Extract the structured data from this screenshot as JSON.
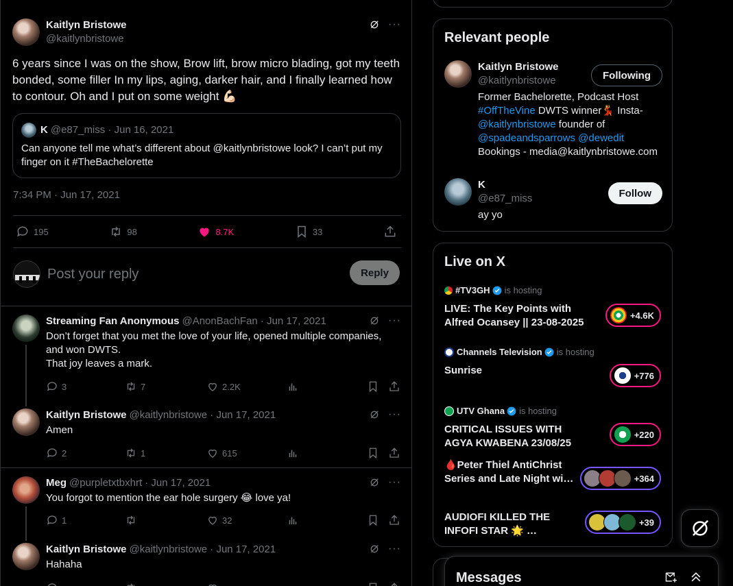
{
  "main_tweet": {
    "author_name": "Kaitlyn Bristowe",
    "author_handle": "@kaitlynbristowe",
    "text": "6 years since I was on the show, Brow lift, brow micro blading, got my teeth bonded, some filler In my lips, aging, darker hair, and I finally learned how to contour. Oh and I put on some weight 💪🏻",
    "quote": {
      "author_name": "K",
      "meta": "@e87_miss · Jun 16, 2021",
      "text": "Can anyone tell me what’s different about @kaitlynbristowe look? I can’t put my finger on it #TheBachelorette"
    },
    "timestamp": "7:34 PM · Jun 17, 2021",
    "stats": {
      "replies": "195",
      "reposts": "98",
      "likes": "8.7K",
      "bookmarks": "33"
    }
  },
  "reply_composer": {
    "placeholder": "Post your reply",
    "button": "Reply"
  },
  "replies": [
    {
      "name": "Streaming Fan Anonymous",
      "meta": "@AnonBachFan · Jun 17, 2021",
      "text": "Don’t forget that you met the love of your life, opened multiple companies, and won DWTS.\nThat joy leaves a mark.",
      "replies": "3",
      "reposts": "7",
      "likes": "2.2K"
    },
    {
      "name": "Kaitlyn Bristowe",
      "meta": "@kaitlynbristowe · Jun 17, 2021",
      "text": "Amen",
      "replies": "2",
      "reposts": "1",
      "likes": "615"
    },
    {
      "name": "Meg",
      "meta": "@purpletxtbxhrt · Jun 17, 2021",
      "text": "You forgot to mention the ear hole surgery 😂 love ya!",
      "replies": "1",
      "reposts": "",
      "likes": "32"
    },
    {
      "name": "Kaitlyn Bristowe",
      "meta": "@kaitlynbristowe · Jun 17, 2021",
      "text": "Hahaha",
      "replies": "",
      "reposts": "",
      "likes": ""
    }
  ],
  "relevant_people": {
    "title": "Relevant people",
    "people": [
      {
        "name": "Kaitlyn Bristowe",
        "handle": "@kaitlynbristowe",
        "button": "Following",
        "bio_1": "Former Bachelorette, Podcast Host ",
        "bio_link_1": "#OffTheVine",
        "bio_2": " DWTS winner💃 Insta- ",
        "bio_link_2": "@kaitlynbristowe",
        "bio_3": " founder of ",
        "bio_link_3": "@spadeandsparrows",
        "bio_link_4": "@dewedit",
        "bio_4": "Bookings - media@kaitlynbristowe.com"
      },
      {
        "name": "K",
        "handle": "@e87_miss",
        "button": "Follow",
        "bio": "ay yo"
      }
    ]
  },
  "live": {
    "title": "Live on X",
    "items": [
      {
        "host": "#TV3GH",
        "hosting": "is hosting",
        "title": "LIVE: The Key Points with Alfred Ocansey || 23-08-2025",
        "count": "+4.6K",
        "border": "#f91880"
      },
      {
        "host": "Channels Television",
        "hosting": "is hosting",
        "title": "Sunrise",
        "count": "+776",
        "border": "#f91880"
      },
      {
        "host": "UTV Ghana",
        "hosting": "is hosting",
        "title": "CRITICAL ISSUES WITH AGYA KWABENA 23/08/25",
        "count": "+220",
        "border": "#f91880"
      },
      {
        "host": "",
        "hosting": "",
        "title": "🩸Peter Thiel AntiChrist Series and Late Night wi…",
        "count": "+364",
        "border": "#7856ff"
      },
      {
        "host": "",
        "hosting": "",
        "title": "AUDIOFI KILLED THE INFOFI STAR 🌟 …",
        "count": "+39",
        "border": "#7856ff"
      }
    ]
  },
  "messages": {
    "title": "Messages"
  }
}
